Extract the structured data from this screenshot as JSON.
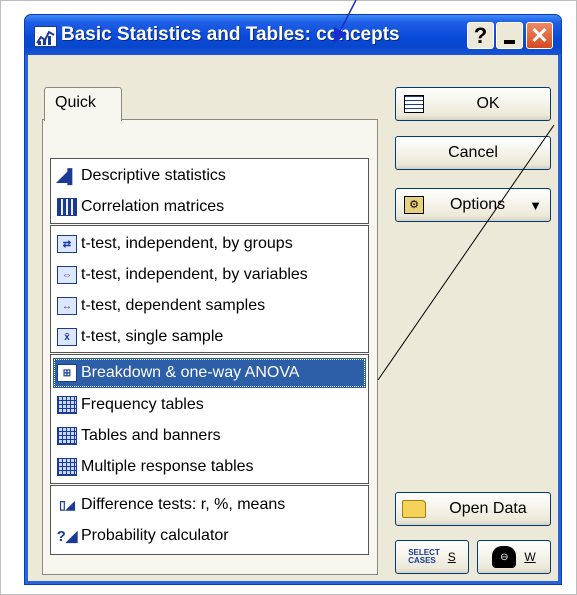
{
  "window": {
    "title": "Basic Statistics and Tables: concepts",
    "help_label": "?",
    "close_label": "✕"
  },
  "tab": {
    "label": "Quick"
  },
  "analyses": {
    "group1": [
      {
        "label": "Descriptive statistics",
        "icon": "descriptive-chart-icon"
      },
      {
        "label": "Correlation matrices",
        "icon": "correlation-matrix-icon"
      }
    ],
    "group2": [
      {
        "label": "t-test, independent, by groups",
        "icon": "ttest-groups-icon"
      },
      {
        "label": "t-test, independent, by variables",
        "icon": "ttest-variables-icon"
      },
      {
        "label": "t-test, dependent samples",
        "icon": "ttest-dependent-icon"
      },
      {
        "label": "t-test, single sample",
        "icon": "ttest-single-icon"
      }
    ],
    "group3": [
      {
        "label": "Breakdown & one-way ANOVA",
        "icon": "breakdown-icon",
        "selected": true
      },
      {
        "label": "Frequency tables",
        "icon": "table-grid-icon"
      },
      {
        "label": "Tables and banners",
        "icon": "table-grid-icon"
      },
      {
        "label": "Multiple response tables",
        "icon": "table-grid-icon"
      }
    ],
    "group4": [
      {
        "label": "Difference tests: r, %, means",
        "icon": "difference-tests-icon"
      },
      {
        "label": "Probability calculator",
        "icon": "probability-calculator-icon"
      }
    ]
  },
  "buttons": {
    "ok": "OK",
    "cancel": "Cancel",
    "options": "Options",
    "open_data": "Open Data",
    "select_cases_line1": "SELECT",
    "select_cases_line2": "CASES",
    "select_cases_key": "S",
    "weight_key": "W"
  },
  "colors": {
    "titlebar": "#0a4ad9",
    "selection": "#2d5ea8",
    "dialog_bg": "#ece9d8"
  }
}
